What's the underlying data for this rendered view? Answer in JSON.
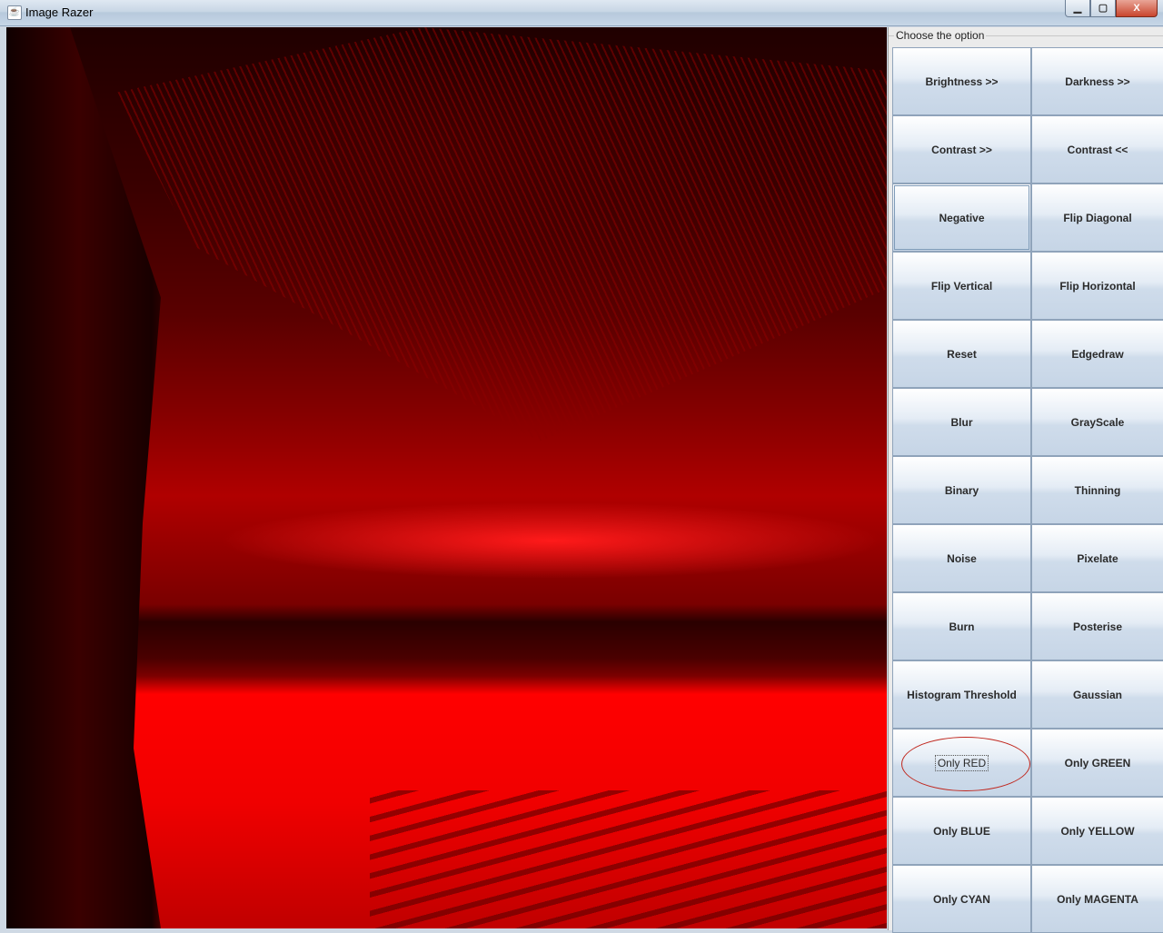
{
  "window": {
    "title": "Image Razer",
    "controls": {
      "minimize": "▁",
      "maximize": "▢",
      "close": "X"
    }
  },
  "panel": {
    "title": "Choose the option",
    "buttons": [
      {
        "label": "Brightness >>"
      },
      {
        "label": "Darkness >>"
      },
      {
        "label": "Contrast >>"
      },
      {
        "label": "Contrast <<"
      },
      {
        "label": "Negative"
      },
      {
        "label": "Flip Diagonal"
      },
      {
        "label": "Flip Vertical"
      },
      {
        "label": "Flip Horizontal"
      },
      {
        "label": "Reset"
      },
      {
        "label": "Edgedraw"
      },
      {
        "label": "Blur"
      },
      {
        "label": "GrayScale"
      },
      {
        "label": "Binary"
      },
      {
        "label": "Thinning"
      },
      {
        "label": "Noise"
      },
      {
        "label": "Pixelate"
      },
      {
        "label": "Burn"
      },
      {
        "label": "Posterise"
      },
      {
        "label": "Histogram Threshold"
      },
      {
        "label": "Gaussian"
      },
      {
        "label": "Only RED"
      },
      {
        "label": "Only GREEN"
      },
      {
        "label": "Only BLUE"
      },
      {
        "label": "Only YELLOW"
      },
      {
        "label": "Only CYAN"
      },
      {
        "label": "Only MAGENTA"
      }
    ]
  },
  "image": {
    "tint": "#ff0000"
  }
}
